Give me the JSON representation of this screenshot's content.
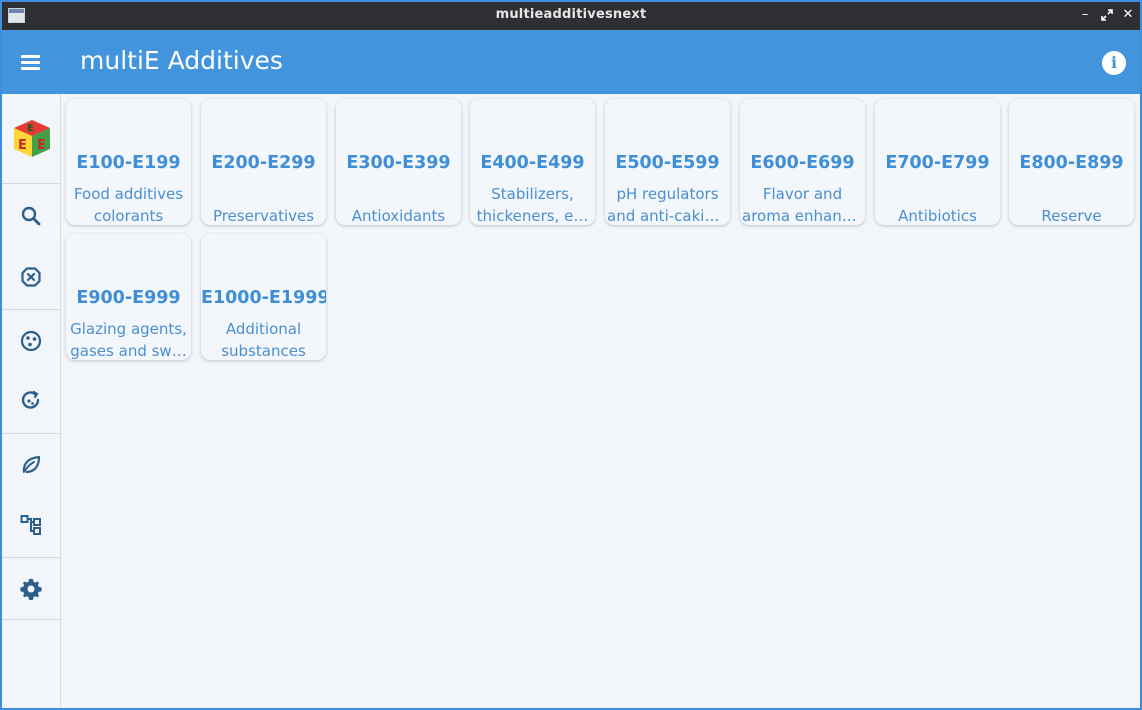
{
  "window": {
    "title": "multieadditivesnext"
  },
  "header": {
    "title": "multiE Additives"
  },
  "colors": {
    "accent": "#4294dd",
    "card_text": "#3f8ed8",
    "titlebar": "#2d2f33",
    "background": "#f2f6fb"
  },
  "sidebar": {
    "items": [
      {
        "icon": "search-icon"
      },
      {
        "icon": "cancel-circle-icon"
      },
      {
        "icon": "cookie-icon"
      },
      {
        "icon": "recycle-icon"
      },
      {
        "icon": "leaf-icon"
      },
      {
        "icon": "hierarchy-icon"
      },
      {
        "icon": "gear-icon"
      }
    ]
  },
  "categories": [
    {
      "range": "E100-E199",
      "line1": "Food additives",
      "line2": "colorants"
    },
    {
      "range": "E200-E299",
      "line1": "",
      "line2": "Preservatives"
    },
    {
      "range": "E300-E399",
      "line1": "",
      "line2": "Antioxidants"
    },
    {
      "range": "E400-E499",
      "line1": "Stabilizers,",
      "line2": "thickeners, e…"
    },
    {
      "range": "E500-E599",
      "line1": "pH regulators",
      "line2": "and anti-cakin…"
    },
    {
      "range": "E600-E699",
      "line1": "Flavor and",
      "line2": "aroma enhanc…"
    },
    {
      "range": "E700-E799",
      "line1": "",
      "line2": "Antibiotics"
    },
    {
      "range": "E800-E899",
      "line1": "",
      "line2": "Reserve"
    },
    {
      "range": "E900-E999",
      "line1": "Glazing agents,",
      "line2": "gases and sw…"
    },
    {
      "range": "E1000-E1999",
      "line1": "Additional",
      "line2": "substances"
    }
  ]
}
